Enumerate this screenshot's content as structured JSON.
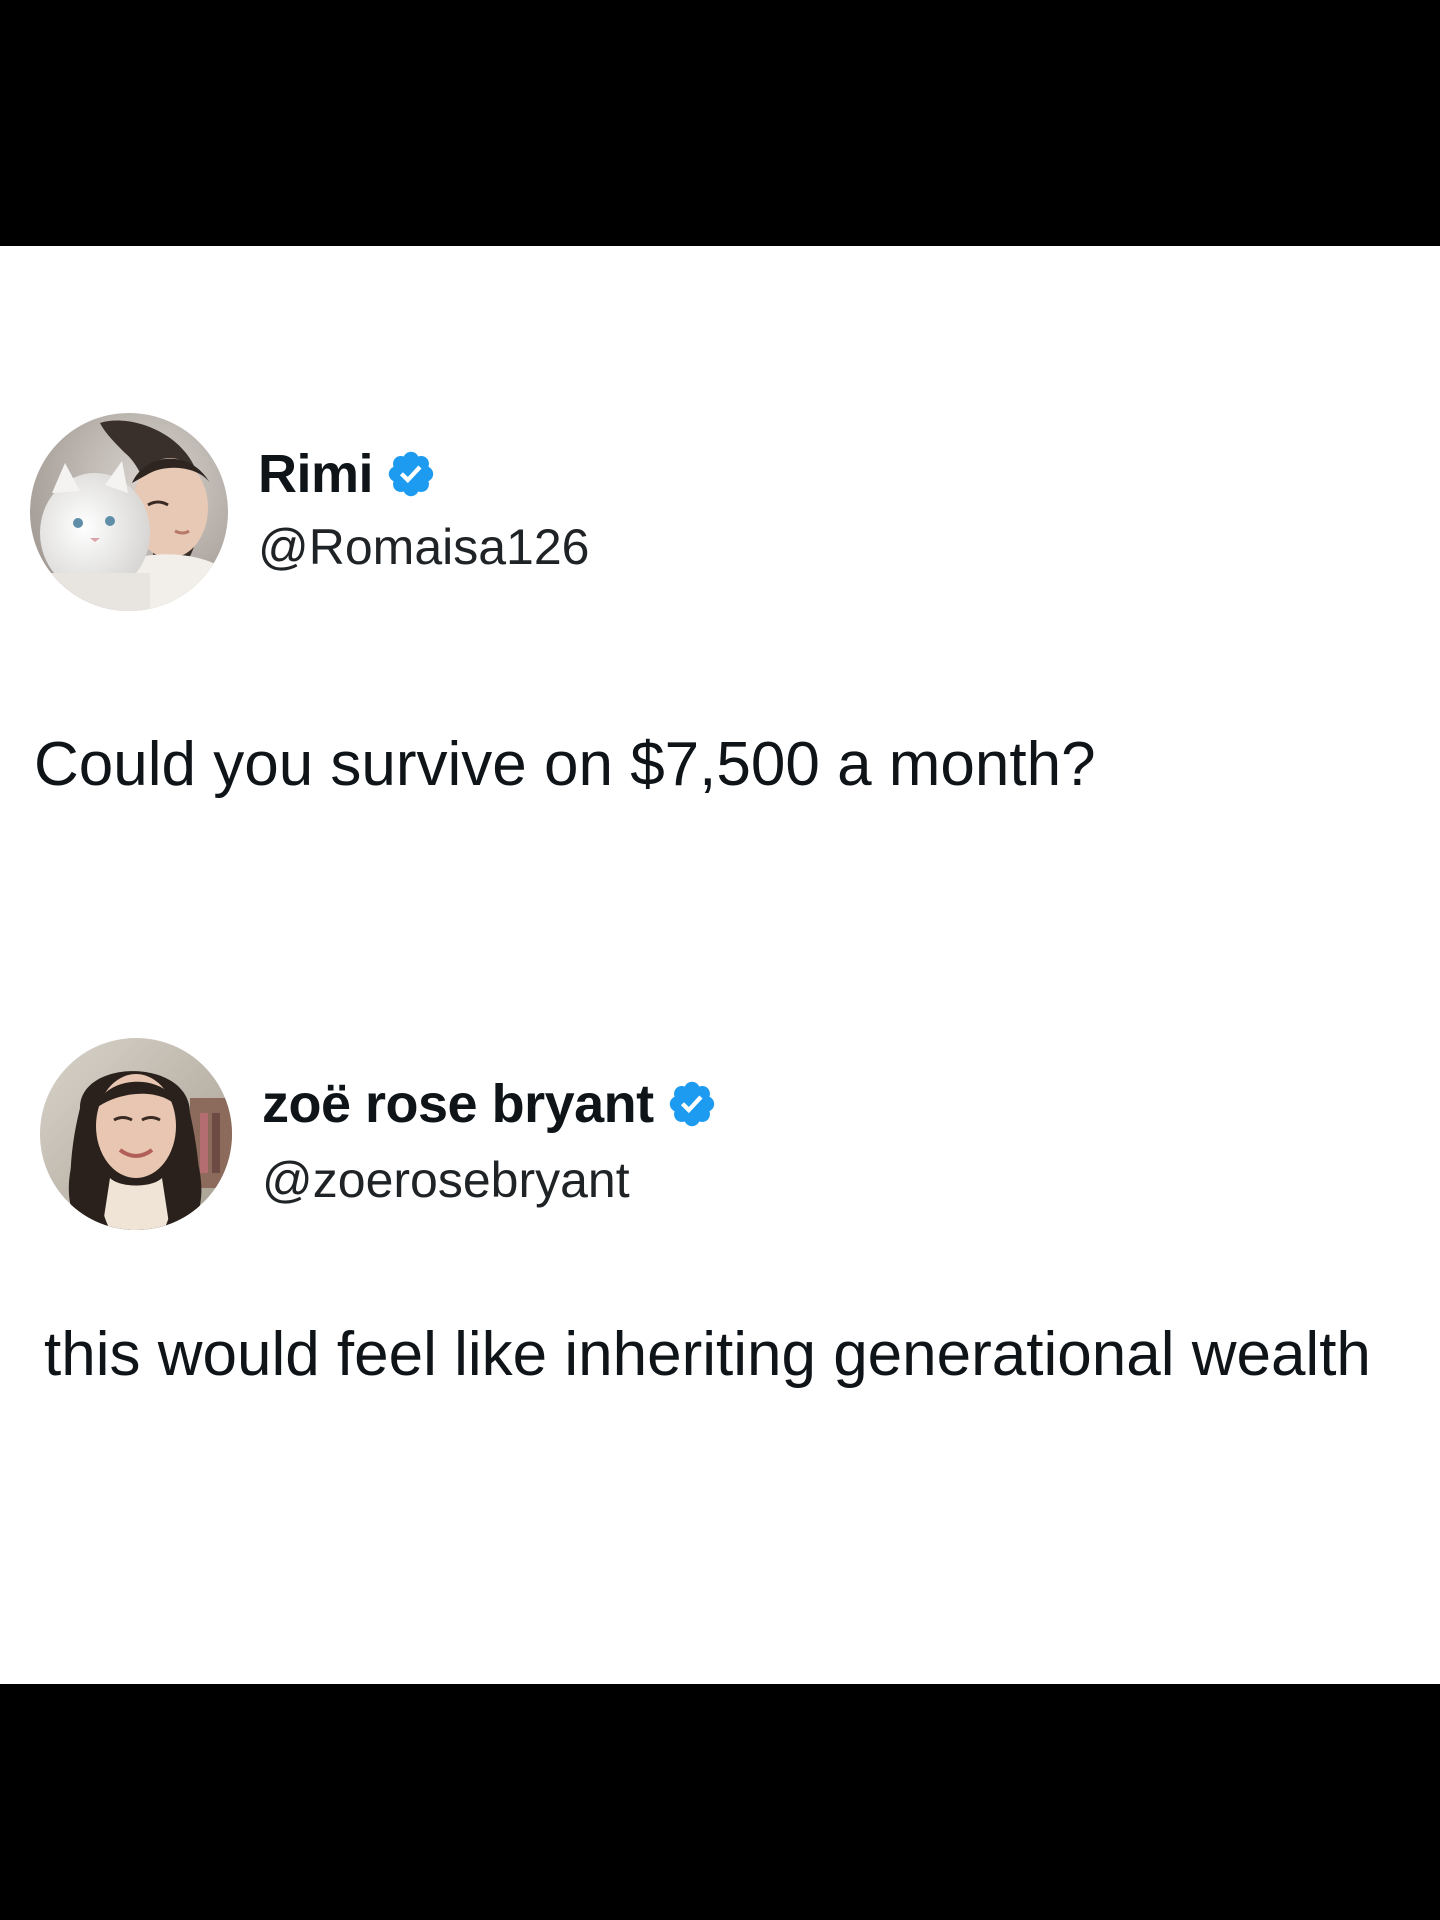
{
  "colors": {
    "frame": "#000000",
    "card": "#ffffff",
    "text": "#0f1419",
    "verified_badge": "#1d9bf0"
  },
  "tweets": [
    {
      "display_name": "Rimi",
      "handle": "@Romaisa126",
      "verified": true,
      "avatar_icon": "avatar-woman-with-white-cat",
      "text": "Could you survive on $7,500 a month?"
    },
    {
      "display_name": "zoë rose bryant",
      "handle": "@zoerosebryant",
      "verified": true,
      "avatar_icon": "avatar-smiling-woman-dark-hair",
      "text": "this would feel like inheriting generational wealth"
    }
  ]
}
